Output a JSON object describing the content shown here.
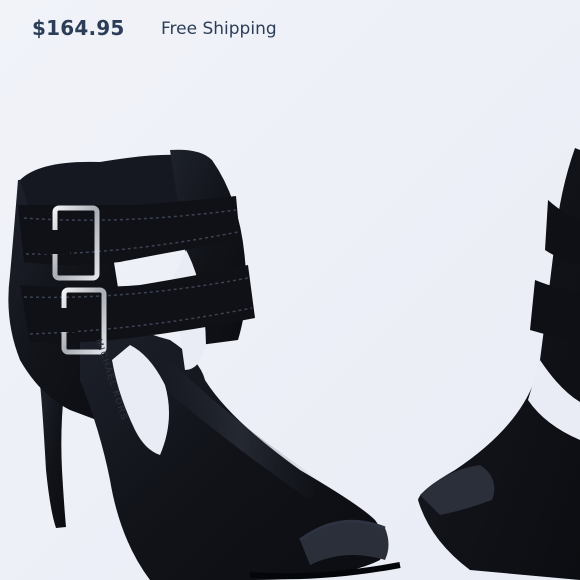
{
  "listing": {
    "price": "$164.95",
    "shipping": "Free Shipping"
  },
  "product_image": {
    "subject": "black-leather-peep-toe-buckle-bootie",
    "brand_embossing": "MICHAEL KORS",
    "colors": {
      "background": "#eef0f7",
      "leather": "#111319",
      "buckle": "#c9ccd2",
      "text": "#2c3e57"
    }
  }
}
